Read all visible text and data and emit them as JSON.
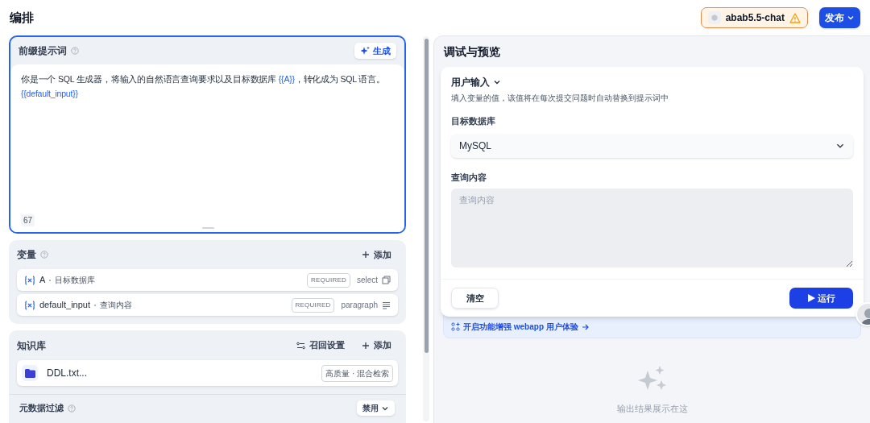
{
  "header": {
    "title": "编排",
    "model": {
      "name": "abab5.5-chat",
      "warning": true
    },
    "publish": {
      "label": "发布"
    }
  },
  "prompt": {
    "title": "前缀提示词",
    "generate": "生成",
    "active": true,
    "lines": [
      [
        {
          "kind": "text",
          "text": "你是一个 SQL 生成器，将输入的自然语言查询要求以及目标数据库 "
        },
        {
          "kind": "variable",
          "text": "{{A}}"
        },
        {
          "kind": "text",
          "text": "，转化成为 SQL 语言。"
        }
      ],
      [
        {
          "kind": "variable",
          "text": "{{default_input}}"
        }
      ]
    ],
    "count": "67"
  },
  "variables": {
    "title": "变量",
    "add": "添加",
    "items": [
      {
        "key": "A",
        "name": "目标数据库",
        "badge": "REQUIRED",
        "type": "select",
        "kind": "select"
      },
      {
        "key": "default_input",
        "name": "查询内容",
        "badge": "REQUIRED",
        "type": "paragraph",
        "kind": "paragraph"
      }
    ]
  },
  "knowledge": {
    "title": "知识库",
    "recall": "召回设置",
    "add": "添加",
    "items": [
      {
        "name": "DDL.txt...",
        "tag": "高质量 · 混合检索"
      }
    ],
    "metadata": {
      "title": "元数据过滤",
      "value": "禁用"
    }
  },
  "preview": {
    "title": "调试与预览",
    "section": "用户输入",
    "hint": "填入变量的值，该值将在每次提交问题时自动替换到提示词中",
    "fields": [
      {
        "kind": "select",
        "label": "目标数据库",
        "value": "MySQL"
      },
      {
        "kind": "textarea",
        "label": "查询内容",
        "placeholder": "查询内容"
      }
    ],
    "clear": "清空",
    "run": "运行",
    "banner": "开启功能增强 webapp 用户体验",
    "empty": "输出结果展示在这"
  }
}
